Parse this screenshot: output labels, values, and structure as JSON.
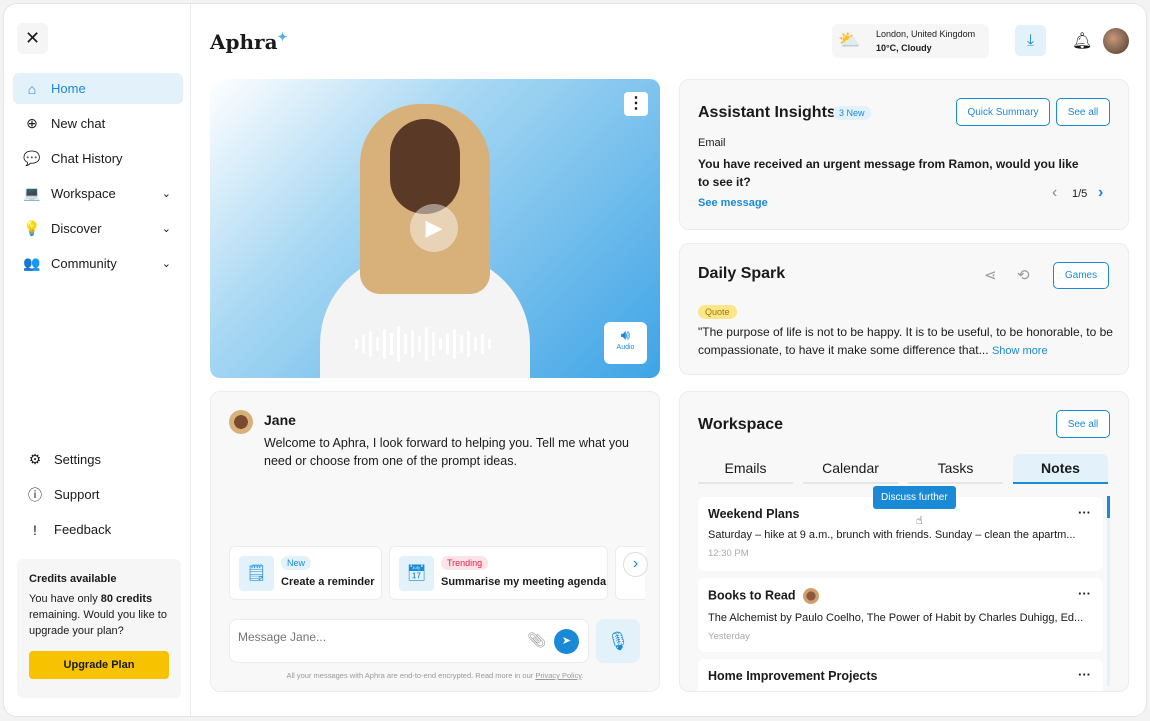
{
  "sidebar": {
    "items": [
      {
        "label": "Home",
        "icon": "home-icon",
        "active": true
      },
      {
        "label": "New chat",
        "icon": "chat-plus-icon"
      },
      {
        "label": "Chat History",
        "icon": "chat-history-icon"
      },
      {
        "label": "Workspace",
        "icon": "laptop-icon",
        "expandable": true
      },
      {
        "label": "Discover",
        "icon": "lightbulb-icon",
        "expandable": true
      },
      {
        "label": "Community",
        "icon": "community-icon",
        "expandable": true
      }
    ],
    "bottom": [
      {
        "label": "Settings",
        "icon": "gear-icon"
      },
      {
        "label": "Support",
        "icon": "help-icon"
      },
      {
        "label": "Feedback",
        "icon": "feedback-icon"
      }
    ],
    "credits": {
      "title": "Credits available",
      "pre": "You have only ",
      "amount": "80 credits",
      "post": " remaining. Would you like to upgrade your plan?",
      "button": "Upgrade Plan"
    }
  },
  "header": {
    "logo": "Aphra",
    "weather": {
      "location": "London, United Kingdom",
      "condition": "10°C, Cloudy"
    }
  },
  "video": {
    "audio_label": "Audio"
  },
  "chat": {
    "name": "Jane",
    "message": "Welcome to Aphra, I look forward to helping you. Tell me what you need or choose from one of the prompt ideas.",
    "prompts": [
      {
        "badge": "New",
        "label": "Create a reminder"
      },
      {
        "badge": "Trending",
        "label": "Summarise my meeting agenda"
      }
    ],
    "placeholder": "Message Jane...",
    "footer": "All your messages with Aphra are end-to-end encrypted. Read more in our ",
    "footer_link": "Privacy Policy",
    "footer_end": "."
  },
  "insights": {
    "title": "Assistant Insights",
    "badge": "3 New",
    "quick_summary": "Quick Summary",
    "see_all": "See all",
    "category": "Email",
    "message": "You have received an urgent message from Ramon, would you like to see it?",
    "link": "See message",
    "pager": "1/5"
  },
  "spark": {
    "title": "Daily Spark",
    "games": "Games",
    "tag": "Quote",
    "quote": "\"The purpose of life is not to be happy. It is to be useful, to be honorable, to be compassionate, to have it make some difference that...",
    "more": "Show more"
  },
  "workspace": {
    "title": "Workspace",
    "see_all": "See all",
    "tabs": [
      "Emails",
      "Calendar",
      "Tasks",
      "Notes"
    ],
    "active_tab": "Notes",
    "tooltip": "Discuss further",
    "notes": [
      {
        "title": "Weekend Plans",
        "desc": "Saturday – hike at 9 a.m., brunch with friends. Sunday – clean the apartm...",
        "meta": "12:30 PM"
      },
      {
        "title": "Books to Read",
        "desc": "The Alchemist by Paulo Coelho, The Power of Habit by Charles Duhigg, Ed...",
        "meta": "Yesterday"
      },
      {
        "title": "Home Improvement Projects",
        "desc": "",
        "meta": ""
      }
    ]
  },
  "colors": {
    "accent": "#1a8ad6",
    "upgrade": "#f7c200",
    "quote_tag": "#fde58a",
    "trending": "#e0224a"
  }
}
